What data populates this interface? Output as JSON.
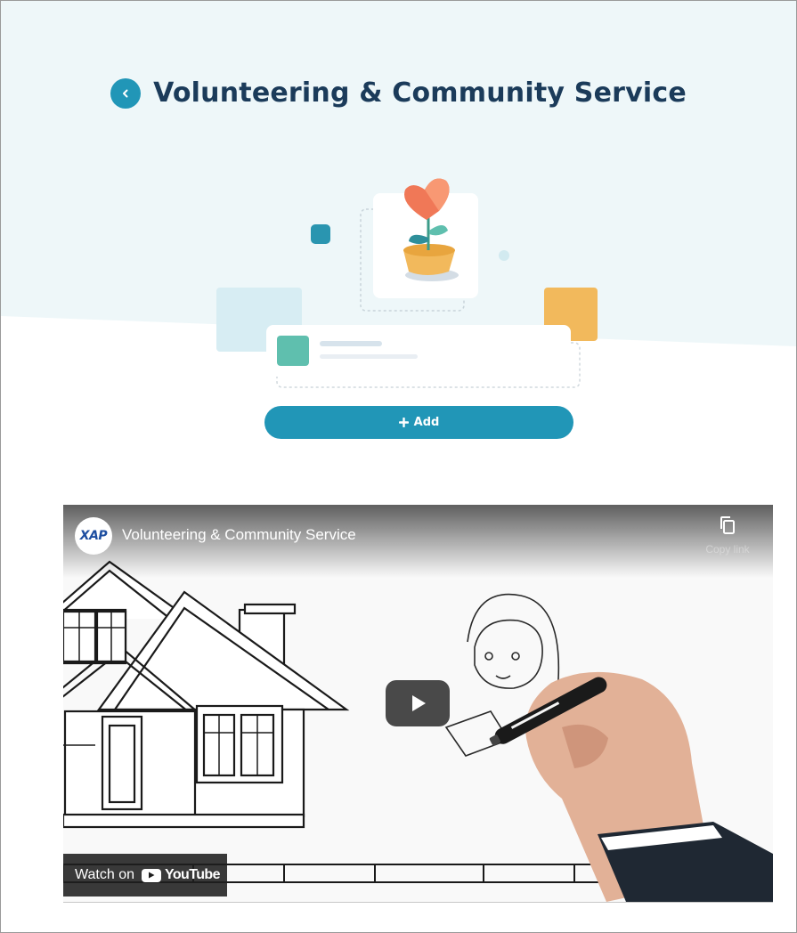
{
  "page": {
    "title": "Volunteering & Community Service",
    "add_button_label": "Add"
  },
  "video": {
    "channel_logo_text": "XAP",
    "title": "Volunteering & Community Service",
    "copy_link_label": "Copy link",
    "watch_on_label": "Watch on",
    "youtube_wordmark": "YouTube"
  },
  "colors": {
    "primary": "#2196b7",
    "title_text": "#1b3b5a",
    "hero_background": "#eef7f9",
    "teal_tile": "#2a95b0",
    "orange_tile": "#f2b95c",
    "green_tile": "#5fbfae"
  },
  "icons": {
    "back": "chevron-left-icon",
    "add": "plus-icon",
    "copy": "copy-icon",
    "play": "play-icon"
  }
}
